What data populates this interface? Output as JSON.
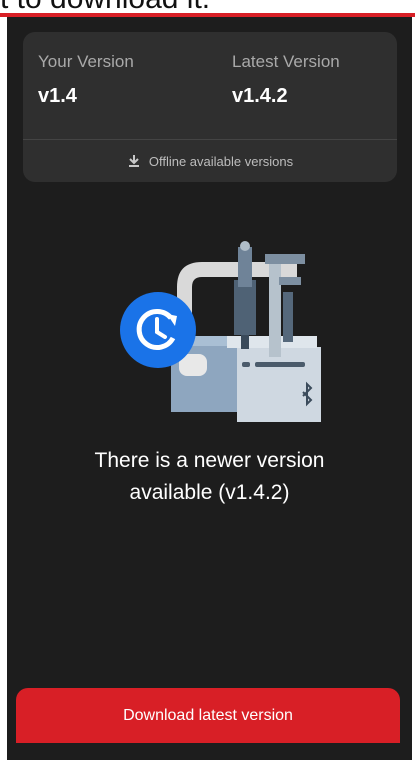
{
  "top_caption": "t to download it.",
  "version_card": {
    "your_version_label": "Your Version",
    "your_version_value": "v1.4",
    "latest_version_label": "Latest Version",
    "latest_version_value": "v1.4.2",
    "offline_link_label": "Offline available versions",
    "offline_link_icon": "download-icon"
  },
  "illustration": {
    "badge_icon": "update-clock-icon",
    "device_icon": "bluetooth-icon"
  },
  "message": {
    "line1": "There is a newer version",
    "line2": "available (v1.4.2)"
  },
  "download_button": {
    "label": "Download latest version"
  },
  "colors": {
    "accent_red": "#d81f26",
    "background": "#1d1d1d",
    "card": "#2f2f2f",
    "badge_blue": "#1a73e8"
  }
}
